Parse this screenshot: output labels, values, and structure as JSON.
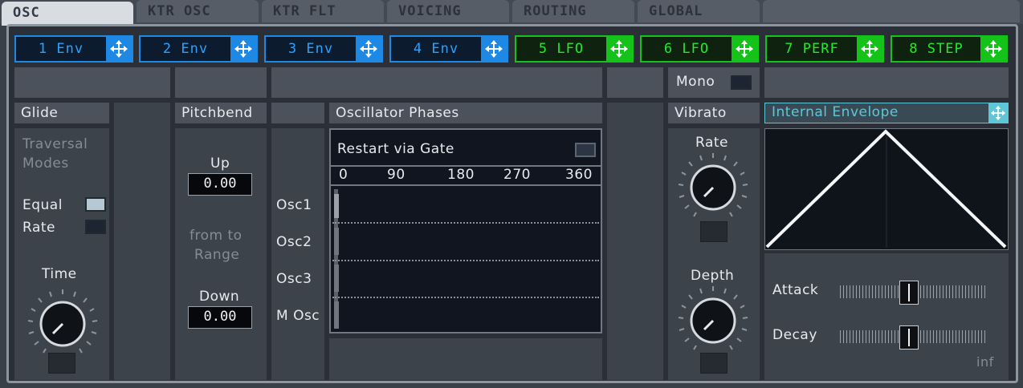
{
  "tabs": [
    "OSC",
    "KTR OSC",
    "KTR FLT",
    "VOICING",
    "ROUTING",
    "GLOBAL"
  ],
  "active_tab": "OSC",
  "mod_buttons": [
    {
      "label": "1 Env",
      "kind": "env"
    },
    {
      "label": "2 Env",
      "kind": "env"
    },
    {
      "label": "3 Env",
      "kind": "env"
    },
    {
      "label": "4 Env",
      "kind": "env"
    },
    {
      "label": "5 LFO",
      "kind": "lfo"
    },
    {
      "label": "6 LFO",
      "kind": "lfo"
    },
    {
      "label": "7 PERF",
      "kind": "lfo"
    },
    {
      "label": "8 STEP",
      "kind": "lfo"
    }
  ],
  "mono": {
    "label": "Mono"
  },
  "glide": {
    "title": "Glide",
    "traversal_line1": "Traversal",
    "traversal_line2": "Modes",
    "equal_label": "Equal",
    "rate_label": "Rate",
    "time_label": "Time"
  },
  "pitchbend": {
    "title": "Pitchbend",
    "up_label": "Up",
    "up_value": "0.00",
    "from_to_line1": "from to",
    "from_to_line2": "Range",
    "down_label": "Down",
    "down_value": "0.00"
  },
  "phases": {
    "title": "Oscillator Phases",
    "restart_label": "Restart via Gate",
    "scale": [
      "0",
      "90",
      "180",
      "270",
      "360"
    ],
    "rows": [
      "Osc1",
      "Osc2",
      "Osc3",
      "M Osc"
    ]
  },
  "vibrato": {
    "title": "Vibrato",
    "rate_label": "Rate",
    "depth_label": "Depth"
  },
  "envelope": {
    "title": "Internal Envelope",
    "attack_label": "Attack",
    "decay_label": "Decay",
    "inf_label": "inf",
    "attack_level": 0.45,
    "decay_level": 0.45
  },
  "colors": {
    "env_blue": "#1e88e5",
    "lfo_green": "#15c21a",
    "envelope_cyan": "#5fc6d6"
  }
}
